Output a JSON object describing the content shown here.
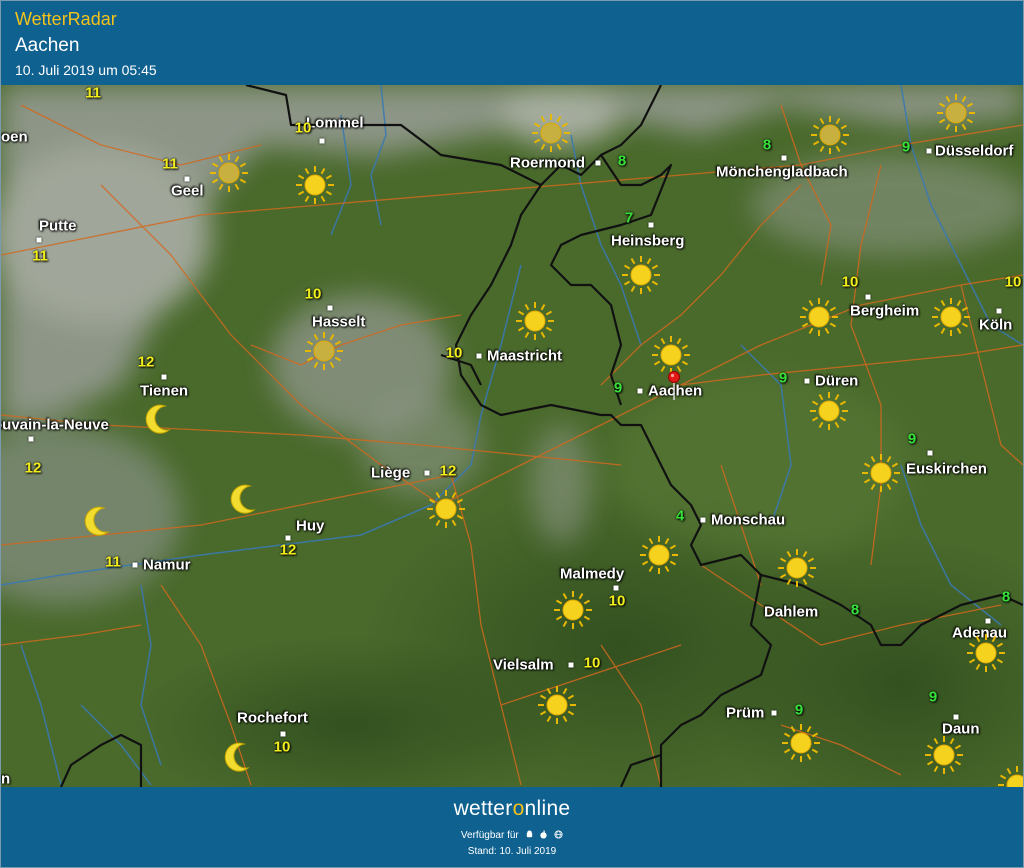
{
  "header": {
    "app_title": "WetterRadar",
    "location": "Aachen",
    "timestamp": "10. Juli 2019 um 05:45"
  },
  "map": {
    "cities": [
      {
        "name": "Lommel"
      },
      {
        "name": "Geel"
      },
      {
        "name": "Putte"
      },
      {
        "name": "Roermond"
      },
      {
        "name": "Mönchengladbach"
      },
      {
        "name": "Düsseldorf"
      },
      {
        "name": "Heinsberg"
      },
      {
        "name": "Hasselt"
      },
      {
        "name": "Maastricht"
      },
      {
        "name": "Bergheim"
      },
      {
        "name": "Köln"
      },
      {
        "name": "Tienen"
      },
      {
        "name": "Aachen"
      },
      {
        "name": "Düren"
      },
      {
        "name": "ouvain-la-Neuve"
      },
      {
        "name": "Euskirchen"
      },
      {
        "name": "Liège"
      },
      {
        "name": "Huy"
      },
      {
        "name": "Monschau"
      },
      {
        "name": "Namur"
      },
      {
        "name": "Malmedy"
      },
      {
        "name": "Dahlem"
      },
      {
        "name": "Adenau"
      },
      {
        "name": "Vielsalm"
      },
      {
        "name": "Prüm"
      },
      {
        "name": "Daun"
      },
      {
        "name": "Rochefort"
      },
      {
        "name": "oen"
      },
      {
        "name": "n"
      }
    ],
    "temperatures": [
      {
        "value": "11",
        "color": "#f2ee1c"
      },
      {
        "value": "10",
        "color": "#f2ee1c"
      },
      {
        "value": "11",
        "color": "#f2ee1c"
      },
      {
        "value": "11",
        "color": "#f2ee1c"
      },
      {
        "value": "8",
        "color": "#36e23a"
      },
      {
        "value": "8",
        "color": "#36e23a"
      },
      {
        "value": "9",
        "color": "#36e23a"
      },
      {
        "value": "7",
        "color": "#36e23a"
      },
      {
        "value": "10",
        "color": "#f2ee1c"
      },
      {
        "value": "10",
        "color": "#f2ee1c"
      },
      {
        "value": "10",
        "color": "#f2ee1c"
      },
      {
        "value": "10",
        "color": "#f2ee1c"
      },
      {
        "value": "12",
        "color": "#f2ee1c"
      },
      {
        "value": "9",
        "color": "#36e23a"
      },
      {
        "value": "9",
        "color": "#36e23a"
      },
      {
        "value": "9",
        "color": "#36e23a"
      },
      {
        "value": "12",
        "color": "#f2ee1c"
      },
      {
        "value": "12",
        "color": "#f2ee1c"
      },
      {
        "value": "12",
        "color": "#f2ee1c"
      },
      {
        "value": "4",
        "color": "#36e23a"
      },
      {
        "value": "11",
        "color": "#f2ee1c"
      },
      {
        "value": "10",
        "color": "#f2ee1c"
      },
      {
        "value": "8",
        "color": "#36e23a"
      },
      {
        "value": "8",
        "color": "#36e23a"
      },
      {
        "value": "10",
        "color": "#f2ee1c"
      },
      {
        "value": "9",
        "color": "#36e23a"
      },
      {
        "value": "9",
        "color": "#36e23a"
      },
      {
        "value": "10",
        "color": "#f2ee1c"
      }
    ],
    "weather_icons": [
      "sun-icon",
      "sun-icon",
      "sun-icon",
      "sun-icon",
      "sun-icon",
      "sun-icon",
      "sun-icon",
      "sun-icon",
      "sun-icon",
      "sun-icon",
      "sun-icon",
      "sun-icon",
      "sun-icon",
      "sun-icon",
      "sun-icon",
      "sun-icon",
      "sun-icon",
      "sun-icon",
      "sun-icon",
      "sun-icon",
      "sun-icon",
      "sun-icon",
      "moon-icon",
      "moon-icon",
      "moon-icon",
      "moon-icon"
    ],
    "selected_marker": "map-pin-icon"
  },
  "footer": {
    "brand_part1": "wetter",
    "brand_o": "o",
    "brand_part2": "nline",
    "available_label": "Verfügbar für",
    "platform_icons": [
      "android-icon",
      "apple-icon",
      "globe-icon"
    ],
    "stand": "Stand: 10. Juli 2019"
  },
  "colors": {
    "header_bg": "#0f6190",
    "title_accent": "#f4c21a",
    "temp_warm": "#f2ee1c",
    "temp_cool": "#36e23a",
    "map_green": "#44602a",
    "border_line": "#111111",
    "road_line": "#d2691e",
    "river_line": "#3a79b0"
  }
}
